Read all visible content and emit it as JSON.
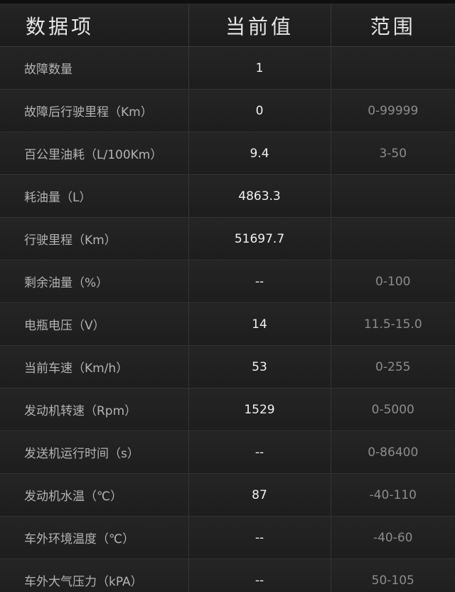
{
  "header": {
    "col_item": "数据项",
    "col_value": "当前值",
    "col_range": "范围"
  },
  "rows": [
    {
      "name": "故障数量",
      "value": "1",
      "range": ""
    },
    {
      "name": "故障后行驶里程（Km）",
      "value": "0",
      "range": "0-99999"
    },
    {
      "name": "百公里油耗（L/100Km）",
      "value": "9.4",
      "range": "3-50"
    },
    {
      "name": "耗油量（L）",
      "value": "4863.3",
      "range": ""
    },
    {
      "name": "行驶里程（Km）",
      "value": "51697.7",
      "range": ""
    },
    {
      "name": "剩余油量（%）",
      "value": "--",
      "range": "0-100"
    },
    {
      "name": "电瓶电压（V）",
      "value": "14",
      "range": "11.5-15.0"
    },
    {
      "name": "当前车速（Km/h）",
      "value": "53",
      "range": "0-255"
    },
    {
      "name": "发动机转速（Rpm）",
      "value": "1529",
      "range": "0-5000"
    },
    {
      "name": "发送机运行时间（s）",
      "value": "--",
      "range": "0-86400"
    },
    {
      "name": "发动机水温（℃）",
      "value": "87",
      "range": "-40-110"
    },
    {
      "name": "车外环境温度（℃）",
      "value": "--",
      "range": "-40-60"
    },
    {
      "name": "车外大气压力（kPA）",
      "value": "--",
      "range": "50-105"
    }
  ]
}
